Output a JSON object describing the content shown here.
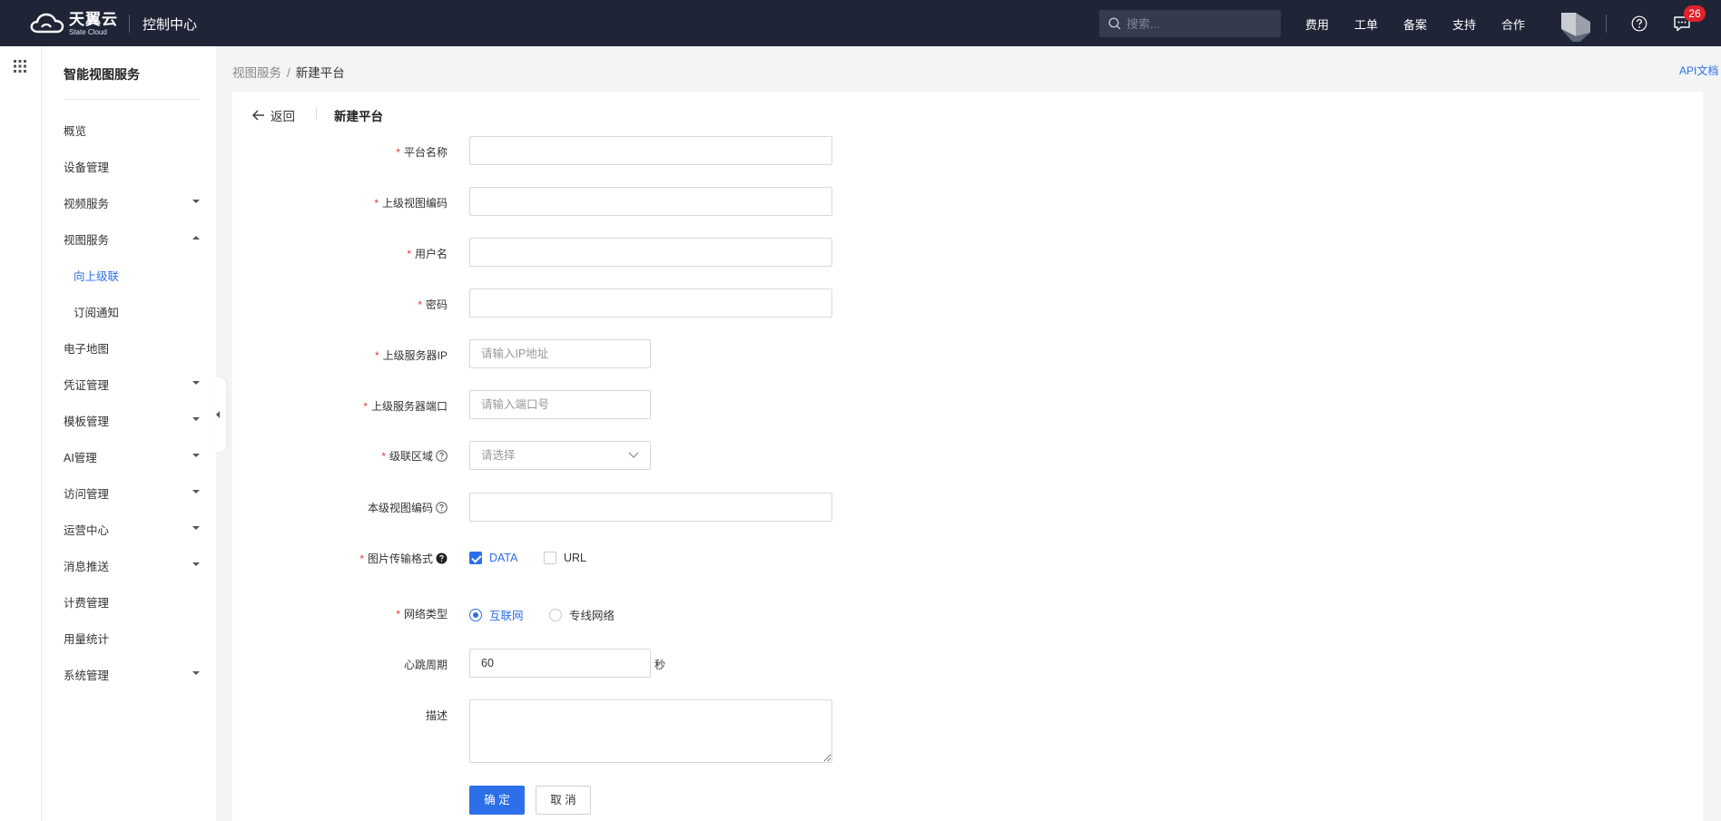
{
  "topbar": {
    "logo_cn": "天翼云",
    "logo_en": "State Cloud",
    "console_title": "控制中心",
    "search_placeholder": "搜索...",
    "nav": [
      "费用",
      "工单",
      "备案",
      "支持",
      "合作"
    ],
    "message_badge": "26"
  },
  "sidebar": {
    "title": "智能视图服务",
    "items": [
      {
        "label": "概览"
      },
      {
        "label": "设备管理"
      },
      {
        "label": "视频服务"
      },
      {
        "label": "视图服务"
      },
      {
        "label": "向上级联"
      },
      {
        "label": "订阅通知"
      },
      {
        "label": "电子地图"
      },
      {
        "label": "凭证管理"
      },
      {
        "label": "模板管理"
      },
      {
        "label": "AI管理"
      },
      {
        "label": "访问管理"
      },
      {
        "label": "运营中心"
      },
      {
        "label": "消息推送"
      },
      {
        "label": "计费管理"
      },
      {
        "label": "用量统计"
      },
      {
        "label": "系统管理"
      }
    ]
  },
  "breadcrumb": {
    "parent": "视图服务",
    "separator": "/",
    "current": "新建平台"
  },
  "api_doc": "API文档",
  "form": {
    "back_label": "返回",
    "title": "新建平台",
    "fields": {
      "platform_name": {
        "label": "平台名称",
        "required": "*"
      },
      "parent_view_code": {
        "label": "上级视图编码",
        "required": "*"
      },
      "username": {
        "label": "用户名",
        "required": "*"
      },
      "password": {
        "label": "密码",
        "required": "*"
      },
      "server_ip": {
        "label": "上级服务器IP",
        "required": "*",
        "placeholder": "请输入IP地址"
      },
      "server_port": {
        "label": "上级服务器端口",
        "required": "*",
        "placeholder": "请输入端口号"
      },
      "cascade_region": {
        "label": "级联区域",
        "required": "*",
        "placeholder": "请选择"
      },
      "local_view_code": {
        "label": "本级视图编码"
      },
      "image_format": {
        "label": "图片传输格式",
        "required": "*",
        "options": [
          "DATA",
          "URL"
        ],
        "selected": "DATA"
      },
      "network_type": {
        "label": "网络类型",
        "required": "*",
        "options": [
          "互联网",
          "专线网络"
        ],
        "selected": "互联网"
      },
      "heartbeat": {
        "label": "心跳周期",
        "value": "60",
        "unit": "秒"
      },
      "description": {
        "label": "描述"
      }
    },
    "confirm_label": "确 定",
    "cancel_label": "取 消"
  },
  "colors": {
    "primary": "#2d6fe8",
    "topbar": "#1f2536",
    "required": "#e23a3a",
    "badge": "#e0222b"
  }
}
